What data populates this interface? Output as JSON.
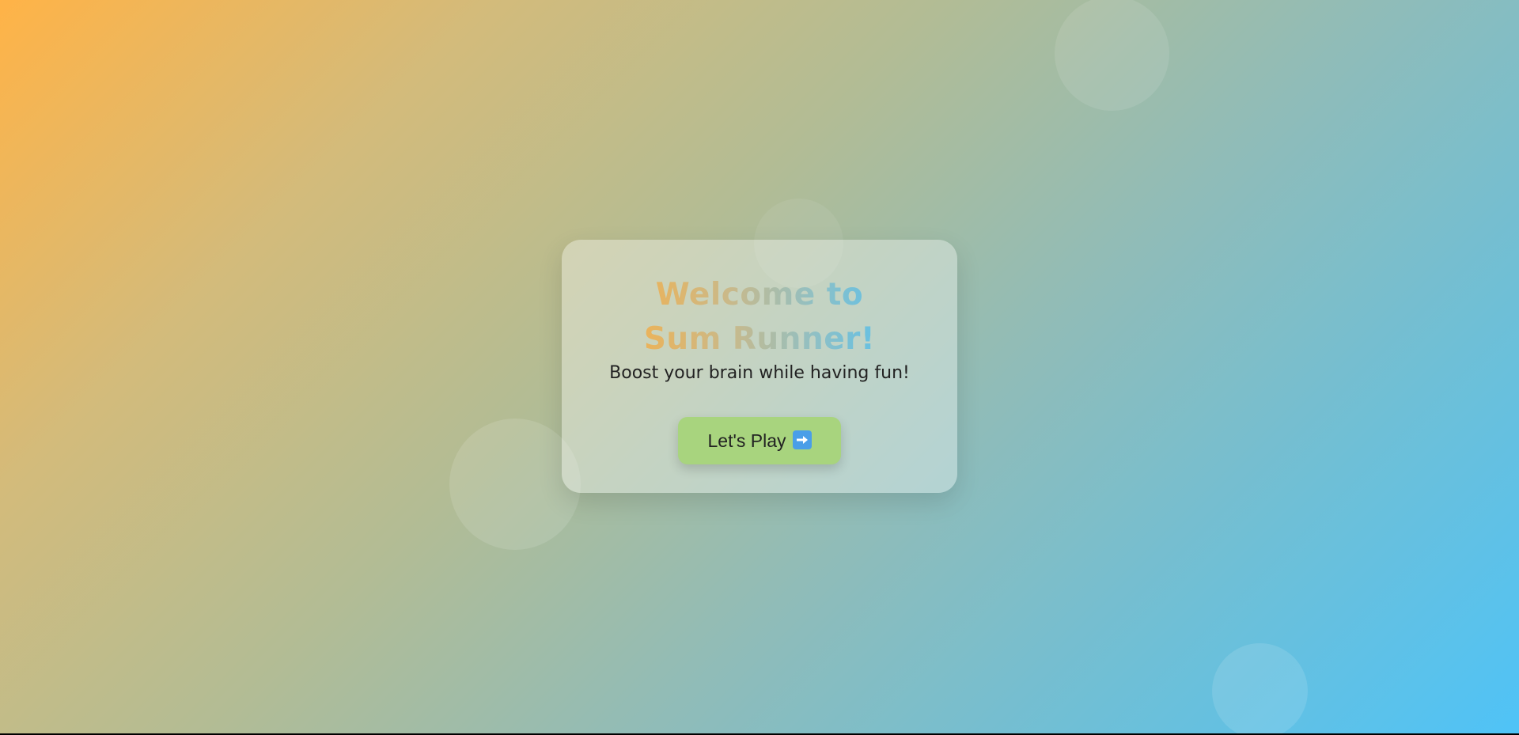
{
  "welcome": {
    "title": "Welcome to Sum Runner!",
    "subtitle": "Boost your brain while having fun!",
    "play_button_label": "Let's Play",
    "play_button_icon": "right-arrow-icon"
  },
  "colors": {
    "background_start": "#ffb347",
    "background_end": "#4fc3f7",
    "button": "#a8d47e",
    "title_gradient_start": "#f5b14c",
    "title_gradient_end": "#55c1ef"
  }
}
